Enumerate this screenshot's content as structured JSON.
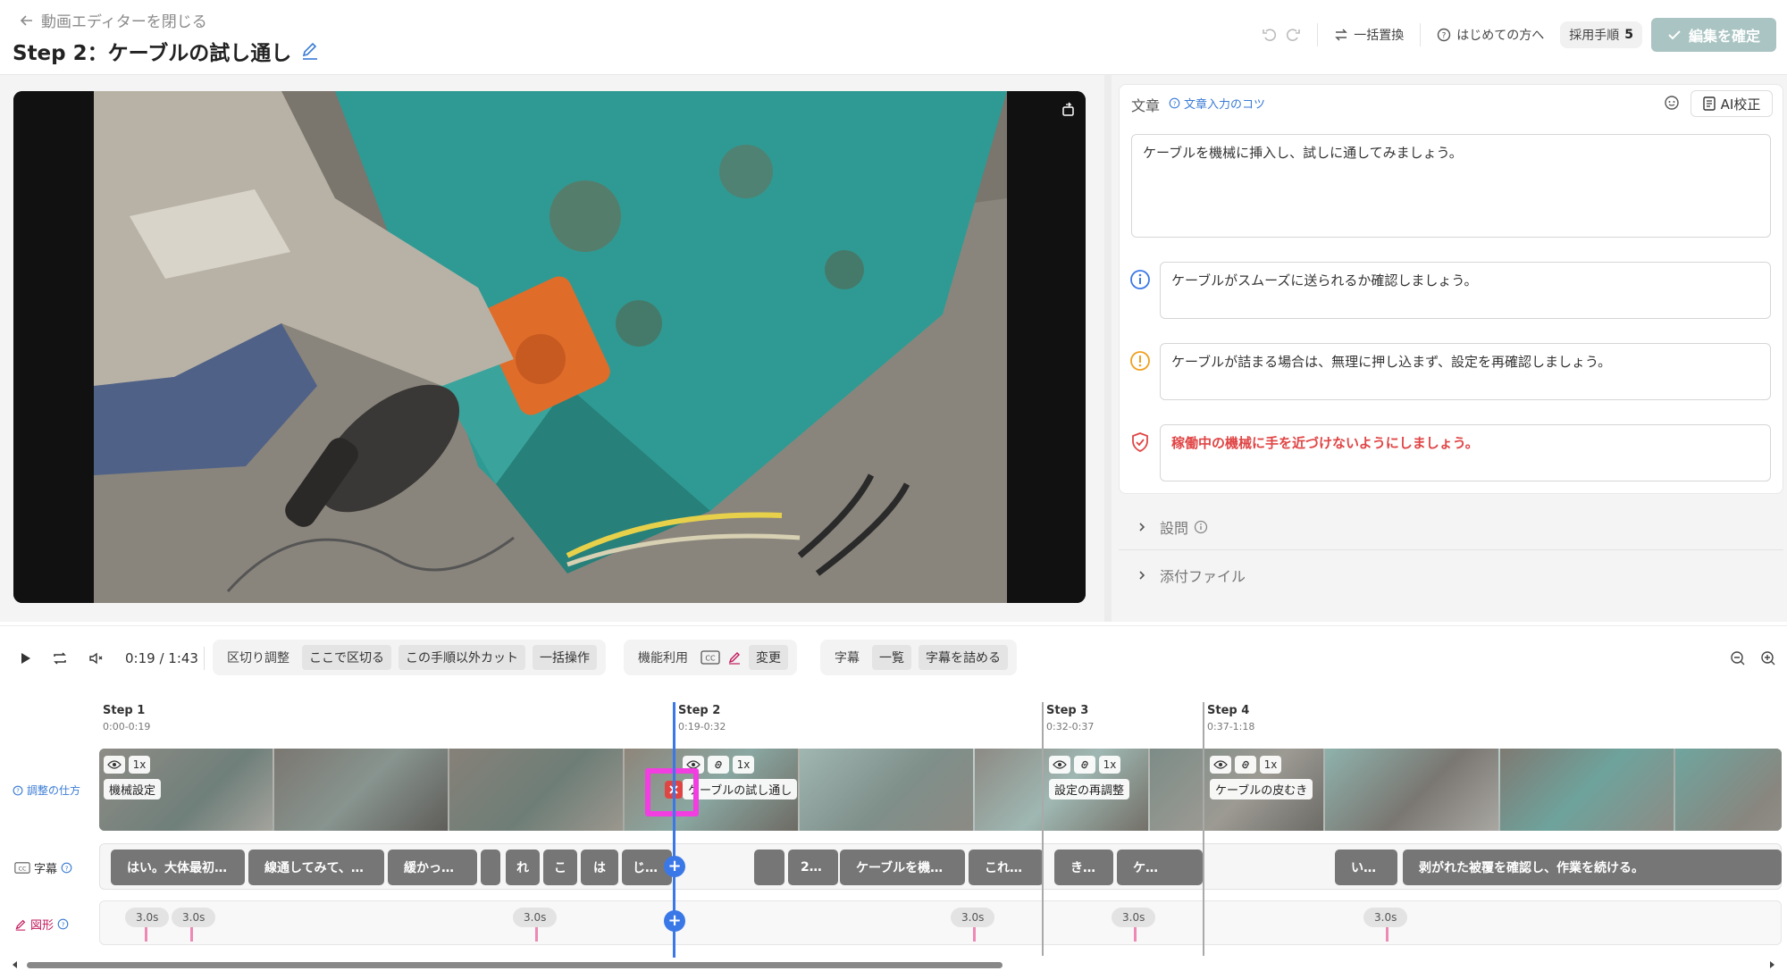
{
  "header": {
    "close_label": "動画エディターを閉じる",
    "title": "Step 2：ケーブルの試し通し",
    "bulk_replace": "一括置換",
    "first_time": "はじめての方へ",
    "adopted_label": "採用手順",
    "adopted_count": "5",
    "confirm": "編集を確定"
  },
  "panel": {
    "section_label": "文章",
    "tip_link": "文章入力のコツ",
    "ai_button": "AI校正",
    "main_text": "ケーブルを機械に挿入し、試しに通してみましょう。",
    "info_text": "ケーブルがスムーズに送られるか確認しましょう。",
    "warning_text": "ケーブルが詰まる場合は、無理に押し込まず、設定を再確認しましょう。",
    "safety_text": "稼働中の機械に手を近づけないようにしましょう。",
    "question_label": "設問",
    "attachment_label": "添付ファイル"
  },
  "toolbar": {
    "time": "0:19 / 1:43",
    "group1": [
      "区切り調整",
      "ここで区切る",
      "この手順以外カット",
      "一括操作"
    ],
    "group2_label": "機能利用",
    "group2_change": "変更",
    "group3": [
      "字幕",
      "一覧",
      "字幕を詰める"
    ]
  },
  "timeline": {
    "steps": [
      {
        "name": "Step 1",
        "range": "0:00-0:19",
        "clip": "機械設定"
      },
      {
        "name": "Step 2",
        "range": "0:19-0:32",
        "clip": "ケーブルの試し通し"
      },
      {
        "name": "Step 3",
        "range": "0:32-0:37",
        "clip": "設定の再調整"
      },
      {
        "name": "Step 4",
        "range": "0:37-1:18",
        "clip": "ケーブルの皮むき"
      }
    ],
    "speed": "1x",
    "adjust_label": "調整の仕方",
    "subtitle_label": "字幕",
    "shape_label": "図形",
    "subtitles": [
      "はい。大体最初…",
      "線通してみて、…",
      "緩かっ…",
      "れ",
      "こ",
      "は",
      "じ…",
      "2…",
      "ケーブルを機…",
      "これ…",
      "き…",
      "ケ…",
      "い…",
      "剥がれた被覆を確認し、作業を続ける。"
    ],
    "shape_duration": "3.0s"
  },
  "colors": {
    "accent": "#3b78e7",
    "confirm_bg": "#a9c4c2",
    "danger": "#e04545",
    "highlight": "#f23ee0"
  }
}
